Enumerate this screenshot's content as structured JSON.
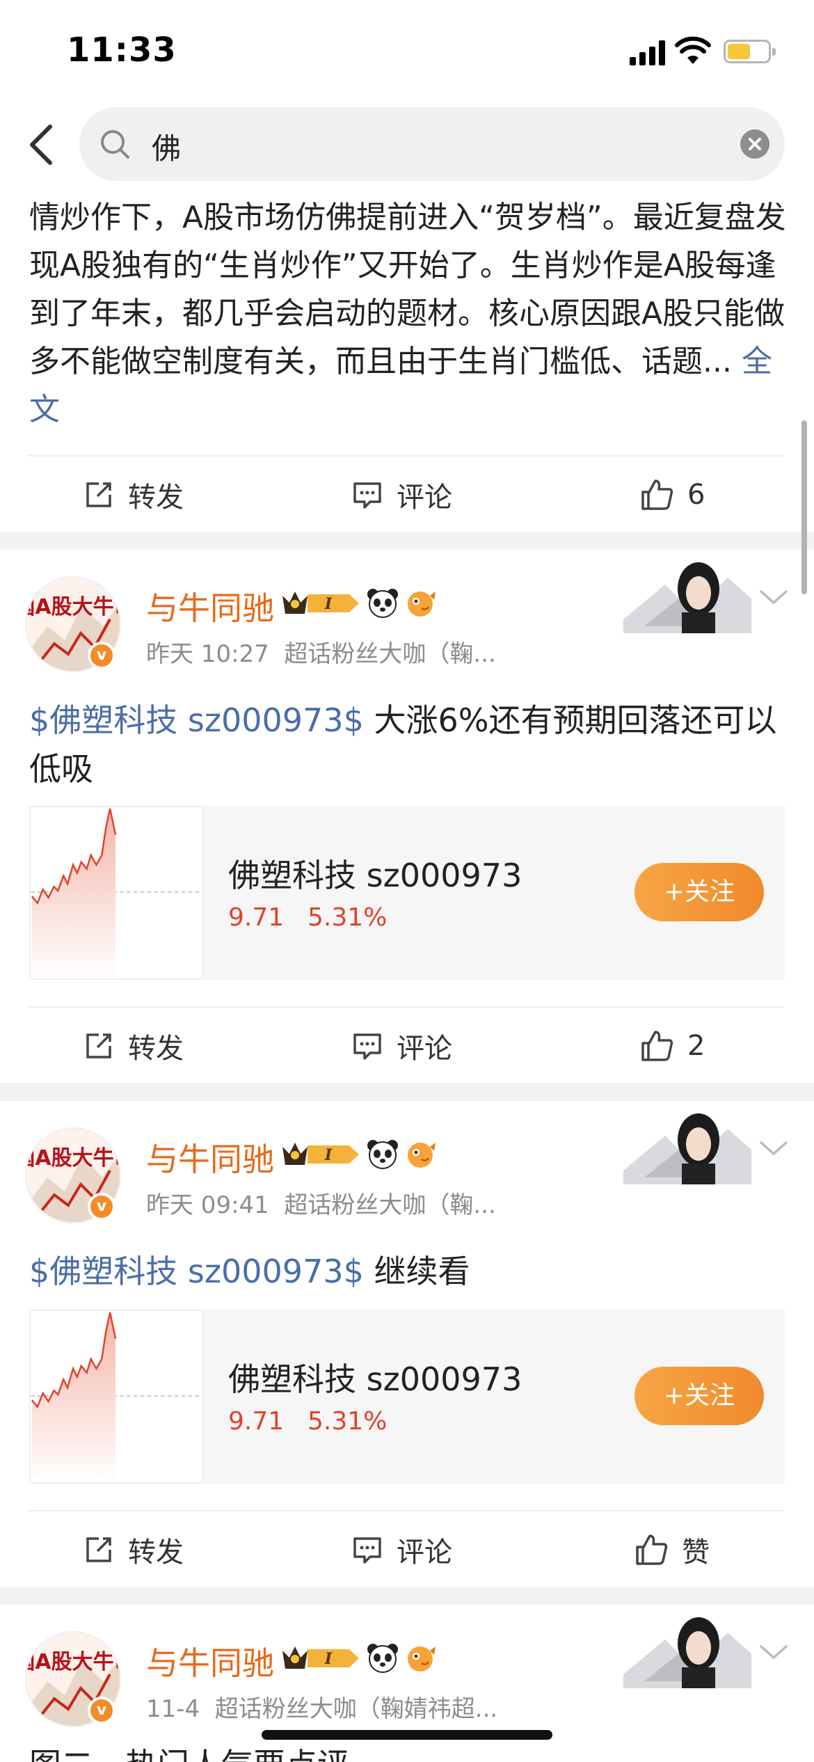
{
  "status_bar": {
    "time": "11:33"
  },
  "search": {
    "query": "佛"
  },
  "first_post": {
    "body": "情炒作下，A股市场仿佛提前进入“贺岁档”。最近复盘发现A股独有的“生肖炒作”又开始了。生肖炒作是A股每逢到了年末，都几乎会启动的题材。核心原因跟A股只能做多不能做空制度有关，而且由于生肖门槛低、话题...",
    "full_text_link": "全文",
    "actions": {
      "repost": "转发",
      "comment": "评论",
      "like": "6"
    }
  },
  "posts": [
    {
      "user": "与牛同驰",
      "avatar_text": "国A股大牛市",
      "time": "昨天 10:27",
      "source": "超话粉丝大咖（鞠...",
      "cashtag": "$佛塑科技 sz000973$",
      "text": " 大涨6%还有预期回落还可以低吸",
      "stock": {
        "name": "佛塑科技 sz000973",
        "price": "9.71",
        "change": "5.31%",
        "follow": "+关注"
      },
      "actions": {
        "repost": "转发",
        "comment": "评论",
        "like": "2"
      }
    },
    {
      "user": "与牛同驰",
      "avatar_text": "国A股大牛市",
      "time": "昨天 09:41",
      "source": "超话粉丝大咖（鞠...",
      "cashtag": "$佛塑科技 sz000973$",
      "text": " 继续看",
      "stock": {
        "name": "佛塑科技 sz000973",
        "price": "9.71",
        "change": "5.31%",
        "follow": "+关注"
      },
      "actions": {
        "repost": "转发",
        "comment": "评论",
        "like": "赞"
      }
    },
    {
      "user": "与牛同驰",
      "avatar_text": "国A股大牛市",
      "time": "11-4",
      "source": "超话粉丝大咖（鞠婧祎超...",
      "peek_text": "图二，热门人气要点评"
    }
  ],
  "colors": {
    "username": "#e86a1a",
    "link": "#4a6ea8",
    "stock_up": "#e2412a",
    "follow_button": "#f08a2c"
  },
  "icons": [
    "back-icon",
    "search-icon",
    "clear-icon",
    "repost-icon",
    "comment-icon",
    "like-icon",
    "crown-badge-icon",
    "panda-icon",
    "fish-icon",
    "chevron-down-icon"
  ]
}
